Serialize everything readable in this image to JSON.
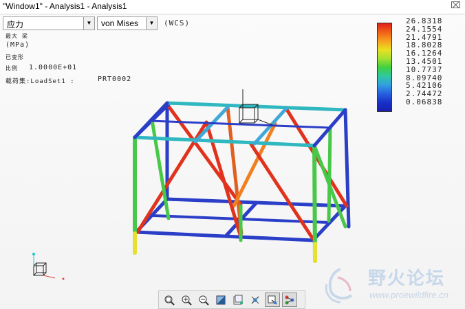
{
  "window": {
    "title": "\"Window1\" - Analysis1 - Analysis1",
    "close_glyph": "⌧"
  },
  "controls": {
    "quantity_select": "应力",
    "component_select": "von Mises",
    "coord_system": "(WCS)"
  },
  "info": {
    "max_label": "最大 梁",
    "unit": "(MPa)",
    "deformed": "已变形",
    "scale_label": "比例",
    "scale_value": "1.0000E+01",
    "loadset_label": "载荷集:LoadSet1 :",
    "loadset_part": "PRT0002"
  },
  "legend": {
    "values": [
      "26.8318",
      "24.1554",
      "21.4791",
      "18.8028",
      "16.1264",
      "13.4501",
      "10.7737",
      "8.09740",
      "5.42106",
      "2.74472",
      "0.06838"
    ]
  },
  "toolbar": {
    "icons": [
      "zoom-fit-icon",
      "zoom-in-icon",
      "zoom-out-icon",
      "shade-icon",
      "view-manager-icon",
      "orient-icon",
      "animate-icon",
      "network-icon"
    ]
  },
  "watermark": {
    "text": "野火论坛",
    "url": "www.proewildfire.cn"
  },
  "colors": {
    "blue": "#2a3ec8",
    "red": "#e0321c",
    "green": "#3cc83c",
    "yellow": "#e8e830",
    "cyan": "#40d8c0"
  }
}
